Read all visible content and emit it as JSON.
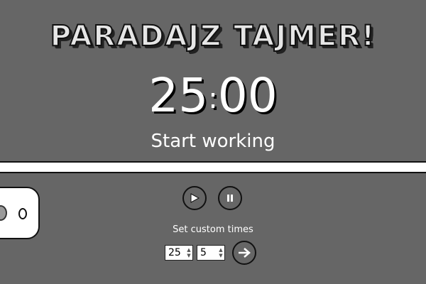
{
  "app": {
    "title": "PARADAJZ TAJMER!"
  },
  "timer": {
    "minutes": "25",
    "separator": ":",
    "seconds": "00",
    "status": "Start working"
  },
  "progress": {
    "fraction": 0
  },
  "controls": {
    "play_icon": "play-icon",
    "pause_icon": "pause-icon"
  },
  "custom": {
    "label": "Set custom times",
    "work_minutes": "25",
    "break_minutes": "5",
    "submit_icon": "arrow-right-icon"
  },
  "colors": {
    "background": "#666666",
    "text": "#ffffff"
  }
}
